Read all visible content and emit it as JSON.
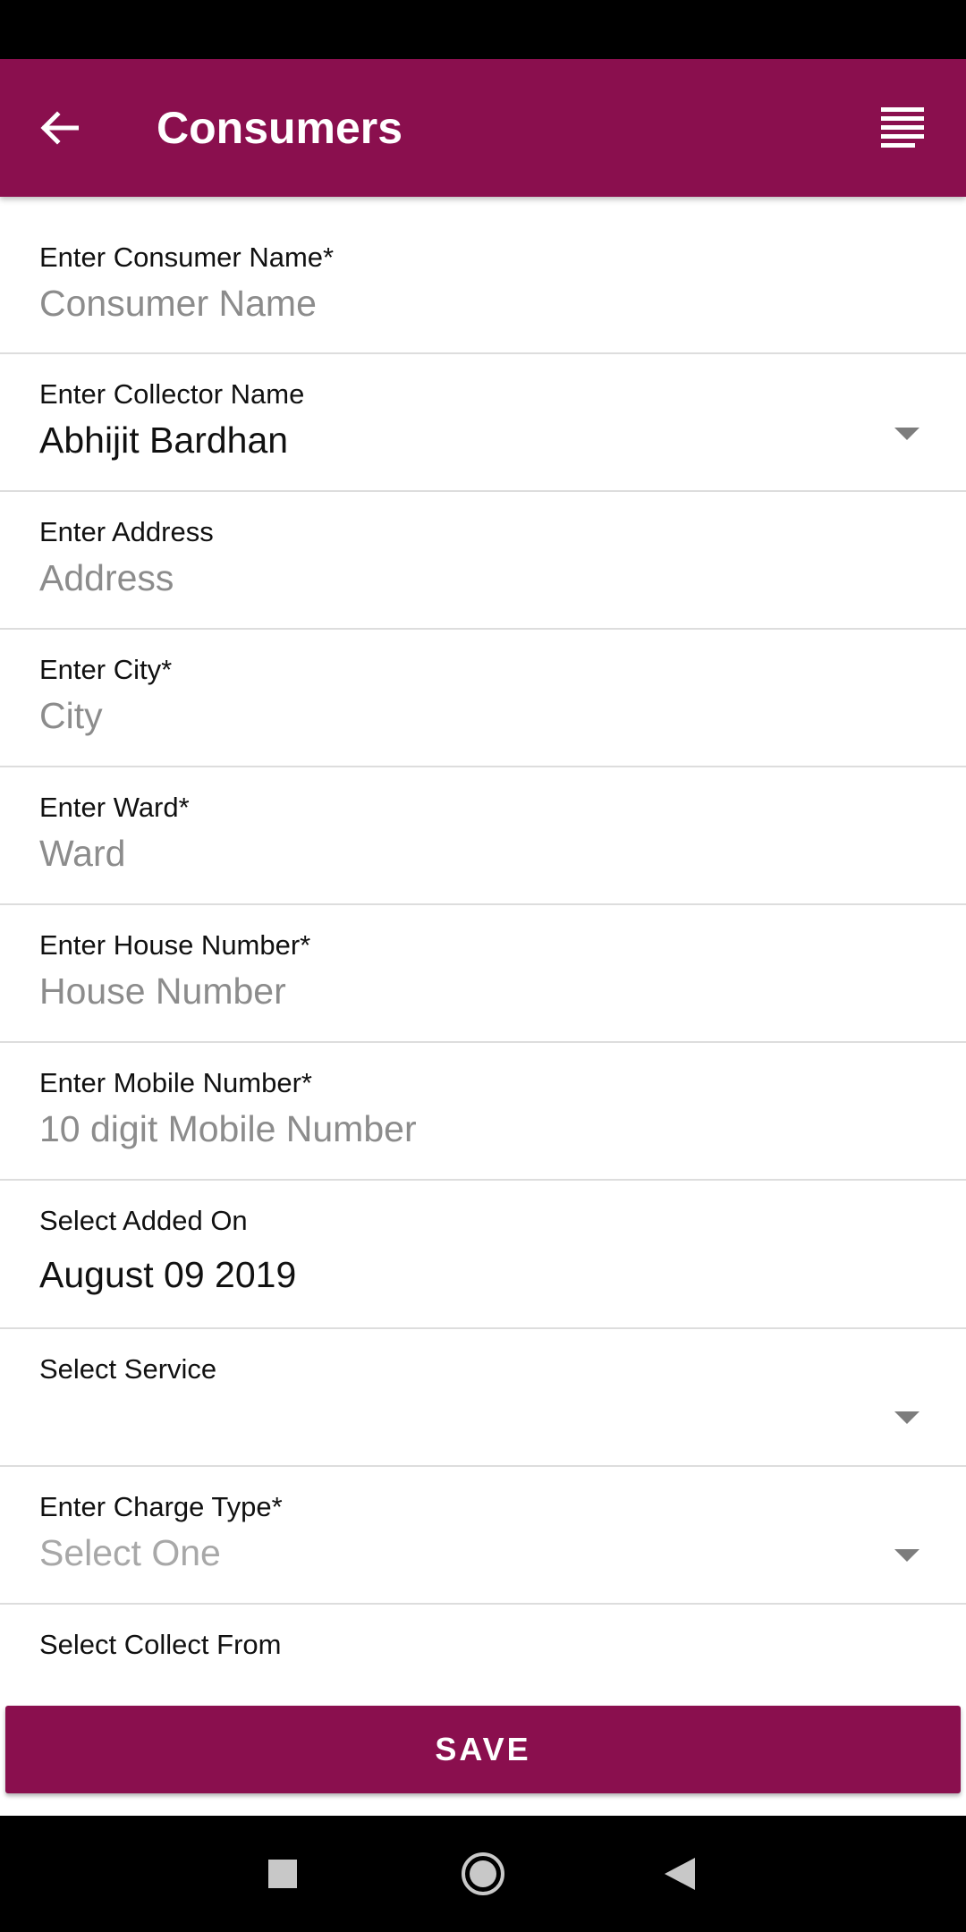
{
  "header": {
    "title": "Consumers",
    "background_color": "#8a0f4e",
    "back_icon": "arrow-left-icon",
    "menu_icon": "menu-lines-icon"
  },
  "form": {
    "consumer_name": {
      "label": "Enter Consumer Name*",
      "placeholder": "Consumer Name"
    },
    "collector_name": {
      "label": "Enter Collector Name",
      "value": "Abhijit Bardhan"
    },
    "address": {
      "label": "Enter Address",
      "placeholder": "Address"
    },
    "city": {
      "label": "Enter City*",
      "placeholder": "City"
    },
    "ward": {
      "label": "Enter Ward*",
      "placeholder": "Ward"
    },
    "house_number": {
      "label": "Enter House Number*",
      "placeholder": "House Number"
    },
    "mobile_number": {
      "label": "Enter Mobile Number*",
      "placeholder": "10 digit Mobile Number"
    },
    "added_on": {
      "label": "Select Added On",
      "value": "August 09 2019"
    },
    "service": {
      "label": "Select Service",
      "value": ""
    },
    "charge_type": {
      "label": "Enter Charge Type*",
      "placeholder": "Select One"
    },
    "collect_from": {
      "label": "Select Collect From"
    }
  },
  "actions": {
    "save_label": "SAVE",
    "accent_color": "#8a0f4e"
  },
  "system_nav": {
    "recents_icon": "square-icon",
    "home_icon": "circle-home-icon",
    "back_icon": "triangle-back-icon"
  }
}
